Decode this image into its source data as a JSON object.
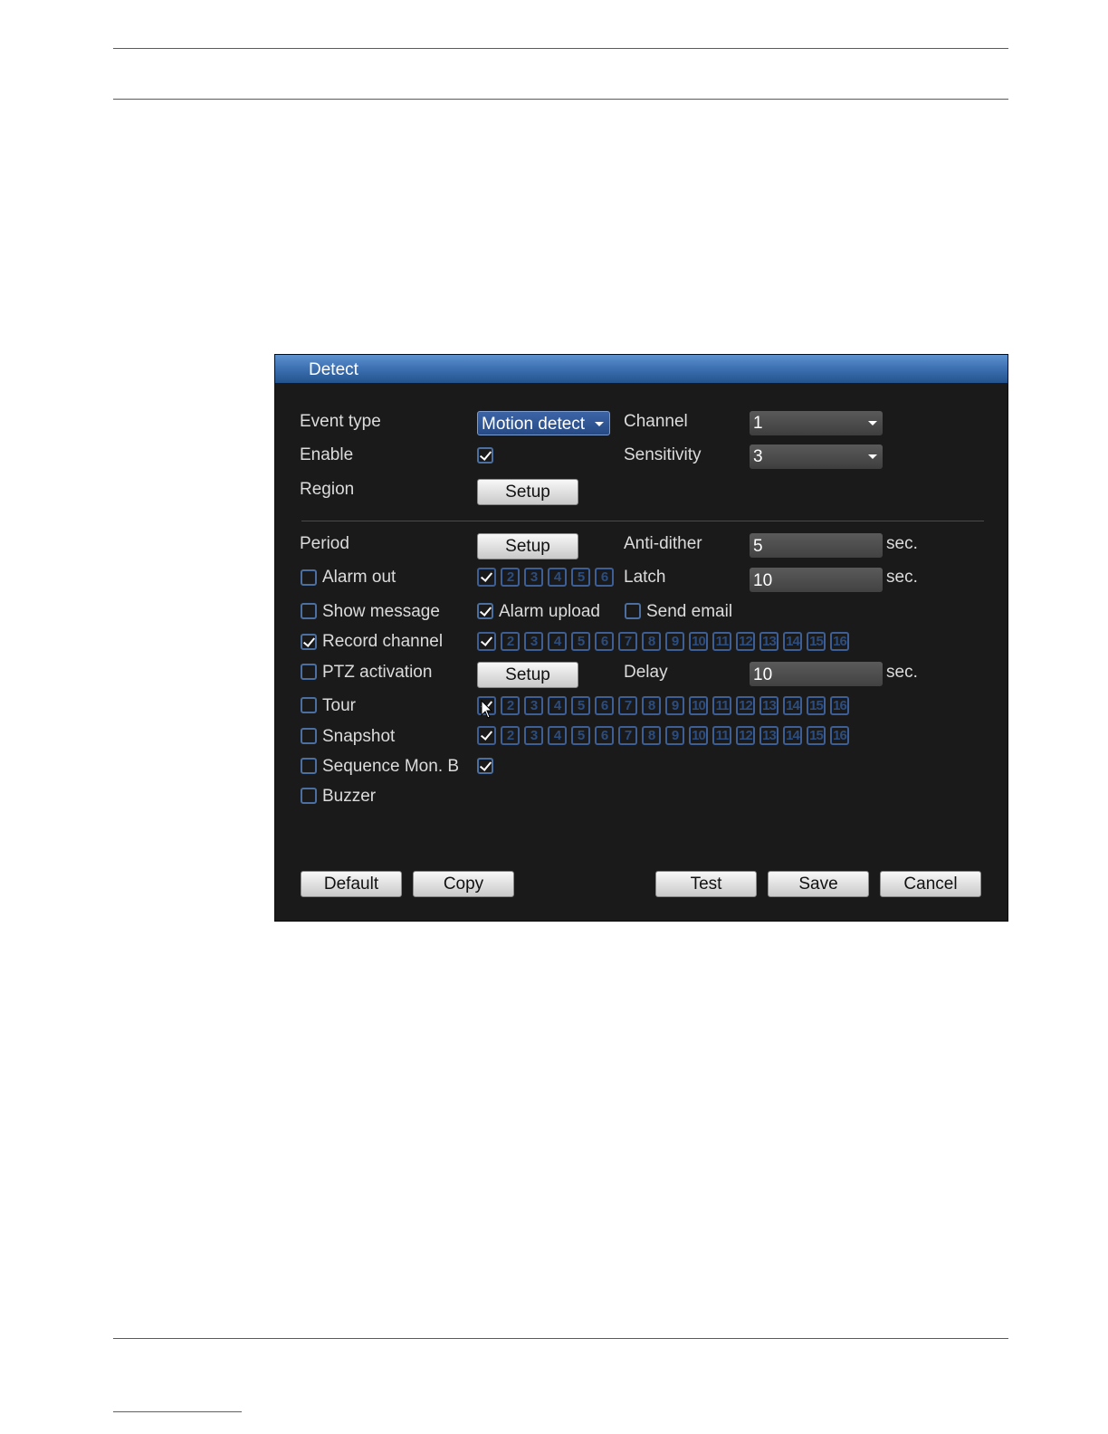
{
  "dialog": {
    "title": "Detect",
    "event_type": {
      "label": "Event type",
      "value": "Motion detect"
    },
    "channel": {
      "label": "Channel",
      "value": "1"
    },
    "enable": {
      "label": "Enable",
      "checked": true
    },
    "sensitivity": {
      "label": "Sensitivity",
      "value": "3"
    },
    "region": {
      "label": "Region",
      "button": "Setup"
    },
    "period": {
      "label": "Period",
      "button": "Setup"
    },
    "anti_dither": {
      "label": "Anti-dither",
      "value": "5",
      "unit": "sec."
    },
    "alarm_out": {
      "label": "Alarm out",
      "checked": false,
      "channels": [
        "1",
        "2",
        "3",
        "4",
        "5",
        "6"
      ],
      "checked_channels": [
        1
      ]
    },
    "latch": {
      "label": "Latch",
      "value": "10",
      "unit": "sec."
    },
    "show_message": {
      "label": "Show message",
      "checked": false
    },
    "alarm_upload": {
      "label": "Alarm upload",
      "checked": true
    },
    "send_email": {
      "label": "Send email",
      "checked": false
    },
    "record_channel": {
      "label": "Record channel",
      "checked": true,
      "checked_channels": [
        1
      ]
    },
    "ptz_activation": {
      "label": "PTZ activation",
      "checked": false,
      "button": "Setup"
    },
    "delay": {
      "label": "Delay",
      "value": "10",
      "unit": "sec."
    },
    "tour": {
      "label": "Tour",
      "checked": false,
      "checked_channels": [
        1
      ]
    },
    "snapshot": {
      "label": "Snapshot",
      "checked": false,
      "checked_channels": [
        1
      ]
    },
    "sequence_mon_b": {
      "label": "Sequence Mon. B",
      "checked": false,
      "option_checked": true
    },
    "buzzer": {
      "label": "Buzzer",
      "checked": false
    },
    "channels16": [
      "1",
      "2",
      "3",
      "4",
      "5",
      "6",
      "7",
      "8",
      "9",
      "10",
      "11",
      "12",
      "13",
      "14",
      "15",
      "16"
    ],
    "buttons": {
      "default": "Default",
      "copy": "Copy",
      "test": "Test",
      "save": "Save",
      "cancel": "Cancel"
    }
  },
  "colors": {
    "titlebar": "#3e72b3",
    "panel": "#1a1a1a",
    "accent": "#4b6fa0"
  },
  "icons": [
    "checkbox-icon",
    "dropdown-arrow-icon",
    "mouse-cursor-icon"
  ]
}
